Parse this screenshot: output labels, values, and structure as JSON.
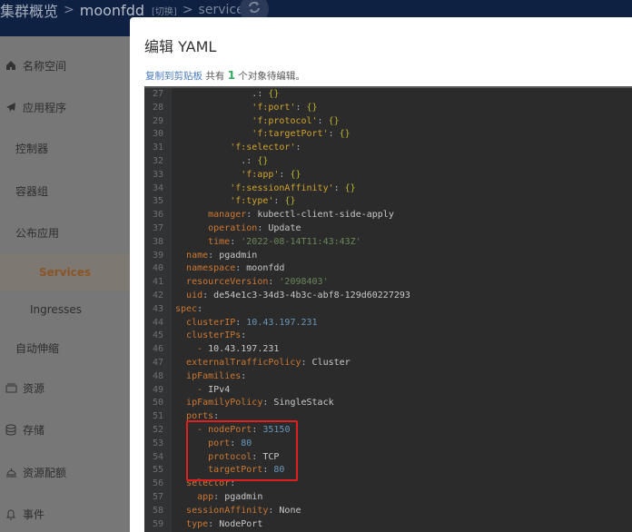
{
  "topbar": {
    "breadcrumb_root": "集群概览",
    "sep": ">",
    "namespace": "moonfdd",
    "switch_label": "[切换]",
    "current": "services",
    "refresh_icon": "refresh-icon"
  },
  "sidebar": {
    "items": [
      {
        "label": "名称空间",
        "icon": "home-icon"
      },
      {
        "label": "应用程序",
        "icon": "paper-plane-icon"
      },
      {
        "label": "控制器"
      },
      {
        "label": "容器组"
      },
      {
        "label": "公布应用"
      },
      {
        "label": "Services",
        "active": true
      },
      {
        "label": "Ingresses"
      },
      {
        "label": "自动伸缩"
      },
      {
        "label": "资源",
        "icon": "box-icon"
      },
      {
        "label": "存储",
        "icon": "database-icon"
      },
      {
        "label": "资源配额",
        "icon": "bell-stand-icon"
      },
      {
        "label": "事件",
        "icon": "bell-icon"
      }
    ],
    "active_color": "#8a5525"
  },
  "modal": {
    "title": "编辑 YAML",
    "copy_link": "复制到剪贴板",
    "info_prefix": " 共有 ",
    "info_count": "1",
    "info_suffix": " 个对象待编辑。"
  },
  "editor": {
    "lines": [
      {
        "n": "27",
        "indent": "              ",
        "tokens": [
          [
            "p",
            ".: "
          ],
          [
            "b",
            "{}"
          ]
        ]
      },
      {
        "n": "28",
        "indent": "              ",
        "tokens": [
          [
            "sq",
            "'f:port'"
          ],
          [
            "p",
            ": "
          ],
          [
            "b",
            "{}"
          ]
        ]
      },
      {
        "n": "29",
        "indent": "              ",
        "tokens": [
          [
            "sq",
            "'f:protocol'"
          ],
          [
            "p",
            ": "
          ],
          [
            "b",
            "{}"
          ]
        ]
      },
      {
        "n": "30",
        "indent": "              ",
        "tokens": [
          [
            "sq",
            "'f:targetPort'"
          ],
          [
            "p",
            ": "
          ],
          [
            "b",
            "{}"
          ]
        ]
      },
      {
        "n": "31",
        "indent": "          ",
        "tokens": [
          [
            "sq",
            "'f:selector'"
          ],
          [
            "p",
            ":"
          ]
        ]
      },
      {
        "n": "32",
        "indent": "            ",
        "tokens": [
          [
            "p",
            ".: "
          ],
          [
            "b",
            "{}"
          ]
        ]
      },
      {
        "n": "33",
        "indent": "            ",
        "tokens": [
          [
            "sq",
            "'f:app'"
          ],
          [
            "p",
            ": "
          ],
          [
            "b",
            "{}"
          ]
        ]
      },
      {
        "n": "34",
        "indent": "          ",
        "tokens": [
          [
            "sq",
            "'f:sessionAffinity'"
          ],
          [
            "p",
            ": "
          ],
          [
            "b",
            "{}"
          ]
        ]
      },
      {
        "n": "35",
        "indent": "          ",
        "tokens": [
          [
            "sq",
            "'f:type'"
          ],
          [
            "p",
            ": "
          ],
          [
            "b",
            "{}"
          ]
        ]
      },
      {
        "n": "36",
        "indent": "      ",
        "tokens": [
          [
            "k",
            "manager"
          ],
          [
            "p",
            ": "
          ],
          [
            "v",
            "kubectl-client-side-apply"
          ]
        ]
      },
      {
        "n": "37",
        "indent": "      ",
        "tokens": [
          [
            "k",
            "operation"
          ],
          [
            "p",
            ": "
          ],
          [
            "v",
            "Update"
          ]
        ]
      },
      {
        "n": "38",
        "indent": "      ",
        "tokens": [
          [
            "k",
            "time"
          ],
          [
            "p",
            ": "
          ],
          [
            "s",
            "'2022-08-14T11:43:43Z'"
          ]
        ]
      },
      {
        "n": "39",
        "indent": "  ",
        "tokens": [
          [
            "k",
            "name"
          ],
          [
            "p",
            ": "
          ],
          [
            "v",
            "pgadmin"
          ]
        ]
      },
      {
        "n": "40",
        "indent": "  ",
        "tokens": [
          [
            "k",
            "namespace"
          ],
          [
            "p",
            ": "
          ],
          [
            "v",
            "moonfdd"
          ]
        ]
      },
      {
        "n": "41",
        "indent": "  ",
        "tokens": [
          [
            "k",
            "resourceVersion"
          ],
          [
            "p",
            ": "
          ],
          [
            "s",
            "'2098403'"
          ]
        ]
      },
      {
        "n": "42",
        "indent": "  ",
        "tokens": [
          [
            "k",
            "uid"
          ],
          [
            "p",
            ": "
          ],
          [
            "v",
            "de54e1c3-34d3-4b3c-abf8-129d60227293"
          ]
        ]
      },
      {
        "n": "43",
        "indent": "",
        "tokens": [
          [
            "k",
            "spec"
          ],
          [
            "p",
            ":"
          ]
        ]
      },
      {
        "n": "44",
        "indent": "  ",
        "tokens": [
          [
            "k",
            "clusterIP"
          ],
          [
            "p",
            ": "
          ],
          [
            "n",
            "10.43.197.231"
          ]
        ]
      },
      {
        "n": "45",
        "indent": "  ",
        "tokens": [
          [
            "k",
            "clusterIPs"
          ],
          [
            "p",
            ":"
          ]
        ]
      },
      {
        "n": "46",
        "indent": "    ",
        "tokens": [
          [
            "k",
            "- "
          ],
          [
            "v",
            "10.43.197.231"
          ]
        ]
      },
      {
        "n": "47",
        "indent": "  ",
        "tokens": [
          [
            "k",
            "externalTrafficPolicy"
          ],
          [
            "p",
            ": "
          ],
          [
            "v",
            "Cluster"
          ]
        ]
      },
      {
        "n": "48",
        "indent": "  ",
        "tokens": [
          [
            "k",
            "ipFamilies"
          ],
          [
            "p",
            ":"
          ]
        ]
      },
      {
        "n": "49",
        "indent": "    ",
        "tokens": [
          [
            "k",
            "- "
          ],
          [
            "v",
            "IPv4"
          ]
        ]
      },
      {
        "n": "50",
        "indent": "  ",
        "tokens": [
          [
            "k",
            "ipFamilyPolicy"
          ],
          [
            "p",
            ": "
          ],
          [
            "v",
            "SingleStack"
          ]
        ]
      },
      {
        "n": "51",
        "indent": "  ",
        "tokens": [
          [
            "k",
            "ports"
          ],
          [
            "p",
            ":"
          ]
        ]
      },
      {
        "n": "52",
        "indent": "    ",
        "tokens": [
          [
            "k",
            "- "
          ],
          [
            "k",
            "nodePort"
          ],
          [
            "p",
            ": "
          ],
          [
            "n",
            "35150"
          ]
        ]
      },
      {
        "n": "53",
        "indent": "      ",
        "tokens": [
          [
            "k",
            "port"
          ],
          [
            "p",
            ": "
          ],
          [
            "n",
            "80"
          ]
        ]
      },
      {
        "n": "54",
        "indent": "      ",
        "tokens": [
          [
            "k",
            "protocol"
          ],
          [
            "p",
            ": "
          ],
          [
            "v",
            "TCP"
          ]
        ]
      },
      {
        "n": "55",
        "indent": "      ",
        "tokens": [
          [
            "k",
            "targetPort"
          ],
          [
            "p",
            ": "
          ],
          [
            "n",
            "80"
          ]
        ]
      },
      {
        "n": "56",
        "indent": "  ",
        "tokens": [
          [
            "k",
            "selector"
          ],
          [
            "p",
            ":"
          ]
        ]
      },
      {
        "n": "57",
        "indent": "    ",
        "tokens": [
          [
            "k",
            "app"
          ],
          [
            "p",
            ": "
          ],
          [
            "v",
            "pgadmin"
          ]
        ]
      },
      {
        "n": "58",
        "indent": "  ",
        "tokens": [
          [
            "k",
            "sessionAffinity"
          ],
          [
            "p",
            ": "
          ],
          [
            "v",
            "None"
          ]
        ]
      },
      {
        "n": "59",
        "indent": "  ",
        "tokens": [
          [
            "k",
            "type"
          ],
          [
            "p",
            ": "
          ],
          [
            "v",
            "NodePort"
          ]
        ]
      }
    ],
    "highlight_color": "#e02020"
  }
}
